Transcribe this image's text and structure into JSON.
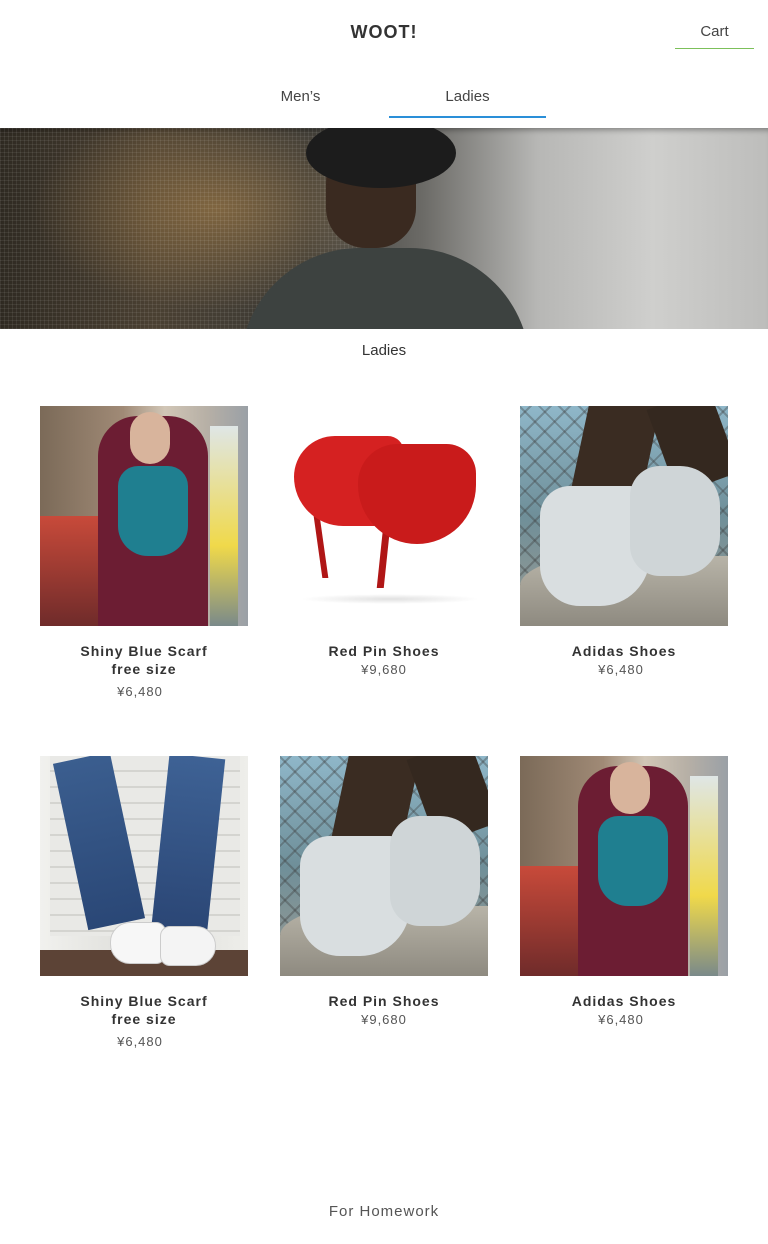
{
  "header": {
    "brand": "WOOT!",
    "cart_label": "Cart",
    "cart_accent": "#7cc05a"
  },
  "tabs": [
    {
      "label": "Men’s",
      "active": false
    },
    {
      "label": "Ladies",
      "active": true
    }
  ],
  "tab_accent": "#2a8fd8",
  "section_title": "Ladies",
  "products": [
    {
      "name": "Shiny Blue Scarf",
      "name_line2": "free size",
      "price": "¥6,480",
      "image": "scarf-photo"
    },
    {
      "name": "Red Pin Shoes",
      "name_line2": "",
      "price": "¥9,680",
      "image": "red-heels-photo"
    },
    {
      "name": "Adidas Shoes",
      "name_line2": "",
      "price": "¥6,480",
      "image": "sneakers-photo"
    },
    {
      "name": "Shiny Blue Scarf",
      "name_line2": "free size",
      "price": "¥6,480",
      "image": "jeans-sneakers-photo"
    },
    {
      "name": "Red Pin Shoes",
      "name_line2": "",
      "price": "¥9,680",
      "image": "sneakers-photo"
    },
    {
      "name": "Adidas Shoes",
      "name_line2": "",
      "price": "¥6,480",
      "image": "scarf-photo"
    }
  ],
  "footer": "For Homework"
}
